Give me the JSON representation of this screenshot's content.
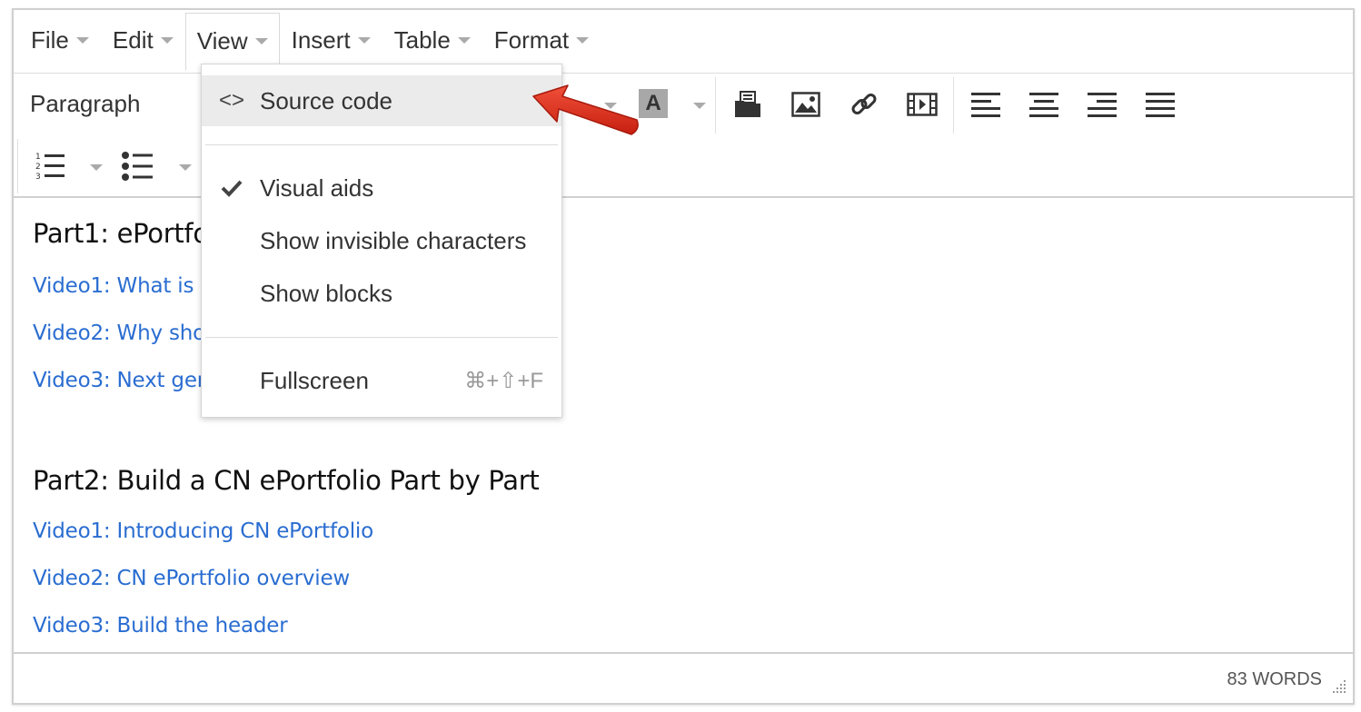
{
  "menubar": {
    "items": [
      {
        "label": "File"
      },
      {
        "label": "Edit"
      },
      {
        "label": "View"
      },
      {
        "label": "Insert"
      },
      {
        "label": "Table"
      },
      {
        "label": "Format"
      }
    ],
    "active": "View"
  },
  "toolbar": {
    "format_select": "Paragraph",
    "bgcolor_glyph": "A"
  },
  "view_menu": {
    "items": [
      {
        "label": "Source code",
        "icon": "code-icon",
        "icon_glyph": "<>",
        "highlighted": true
      },
      {
        "label": "Visual aids",
        "icon": "checkmark-icon",
        "checked": true
      },
      {
        "label": "Show invisible characters"
      },
      {
        "label": "Show blocks"
      },
      {
        "label": "Fullscreen",
        "shortcut": "⌘+⇧+F"
      }
    ]
  },
  "content": {
    "heading1": "Part1: ePortfo",
    "part1_links": [
      "Video1: What is",
      "Video2: Why sho",
      "Video3: Next gen"
    ],
    "heading2": "Part2: Build a CN ePortfolio Part by Part",
    "part2_links": [
      "Video1: Introducing CN ePortfolio",
      "Video2: CN ePortfolio overview",
      "Video3: Build the header"
    ]
  },
  "statusbar": {
    "word_count": "83 WORDS"
  },
  "colors": {
    "link": "#2a6dd1",
    "arrow": "#e0301e",
    "hover": "#ebebeb"
  }
}
